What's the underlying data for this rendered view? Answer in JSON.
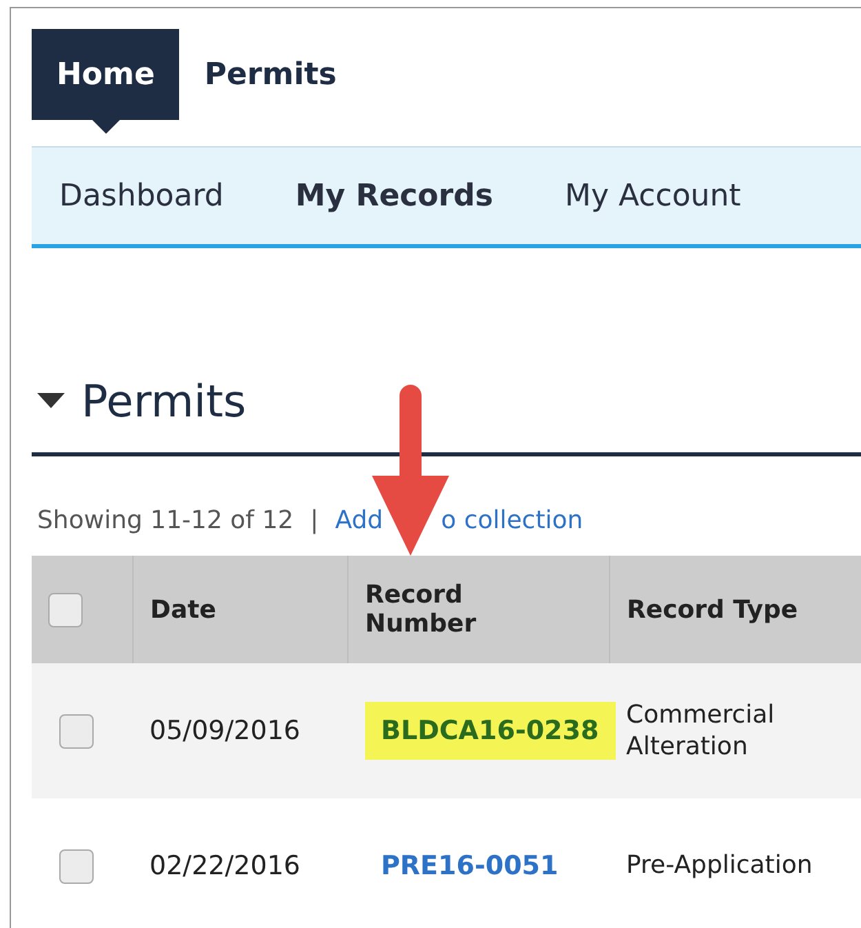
{
  "top_nav": [
    {
      "label": "Home",
      "selected": true
    },
    {
      "label": "Permits",
      "selected": false
    }
  ],
  "sub_nav": [
    {
      "label": "Dashboard",
      "selected": false
    },
    {
      "label": "My Records",
      "selected": true
    },
    {
      "label": "My Account",
      "selected": false
    }
  ],
  "section": {
    "title": "Permits",
    "expanded": true
  },
  "summary": {
    "text": "Showing 11-12 of 12",
    "separator": "|",
    "link_parts": [
      "Add",
      "o collection"
    ]
  },
  "table": {
    "select_all_checked": false,
    "columns": [
      "Date",
      "Record Number",
      "Record Type"
    ],
    "rows": [
      {
        "checked": false,
        "date": "05/09/2016",
        "record_number": "BLDCA16-0238",
        "highlighted": true,
        "record_type": "Commercial Alteration"
      },
      {
        "checked": false,
        "date": "02/22/2016",
        "record_number": "PRE16-0051",
        "highlighted": false,
        "record_type": "Pre-Application"
      }
    ]
  },
  "annotation": {
    "kind": "arrow"
  }
}
